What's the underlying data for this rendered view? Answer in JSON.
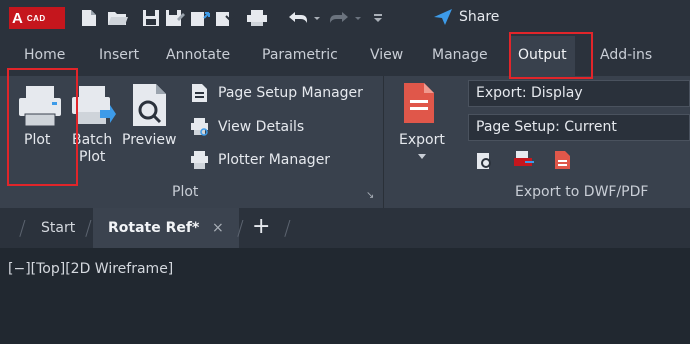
{
  "app": {
    "logo_letter": "A",
    "logo_text": "CAD",
    "share_label": "Share"
  },
  "quick_access": {
    "icons": [
      "new-icon",
      "open-icon",
      "save-icon",
      "save-as-icon",
      "upload-icon",
      "download-icon",
      "plot-icon",
      "undo-icon",
      "redo-icon",
      "customize-icon"
    ]
  },
  "tabs": [
    {
      "label": "Home"
    },
    {
      "label": "Insert"
    },
    {
      "label": "Annotate"
    },
    {
      "label": "Parametric"
    },
    {
      "label": "View"
    },
    {
      "label": "Manage"
    },
    {
      "label": "Output",
      "active": true
    },
    {
      "label": "Add-ins"
    }
  ],
  "ribbon": {
    "plot_panel": {
      "title": "Plot",
      "plot_label": "Plot",
      "batch_plot_label_1": "Batch",
      "batch_plot_label_2": "Plot",
      "preview_label": "Preview",
      "page_setup_manager": "Page Setup Manager",
      "view_details": "View Details",
      "plotter_manager": "Plotter Manager"
    },
    "export_panel": {
      "title": "Export to DWF/PDF",
      "export_label": "Export",
      "export_dropdown": "Export: Display",
      "page_setup_dropdown": "Page Setup: Current"
    }
  },
  "file_tabs": {
    "start": "Start",
    "active": "Rotate Ref*",
    "close": "×",
    "add": "+"
  },
  "viewport": {
    "label": "[−][Top][2D Wireframe]"
  },
  "colors": {
    "highlight": "#e1252a",
    "logo_red": "#c5161d",
    "accent_blue": "#3d9be9"
  }
}
